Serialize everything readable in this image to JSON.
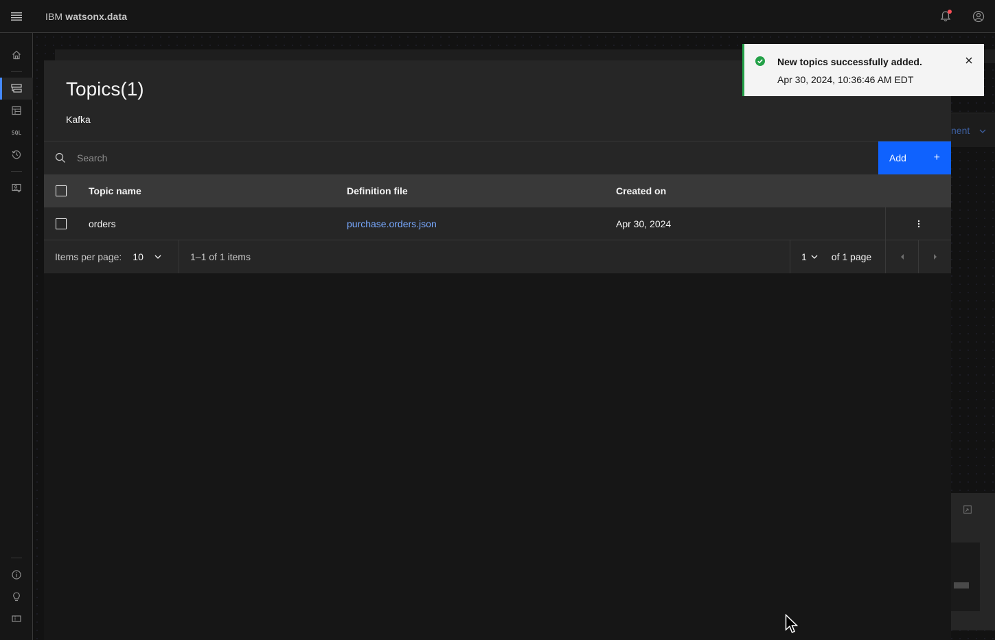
{
  "header": {
    "brand_prefix": "IBM",
    "brand_name": "watsonx.data"
  },
  "icons": {
    "menu": "hamburger-menu-icon",
    "notifications": "bell-icon",
    "user": "user-avatar-icon"
  },
  "sidenav": {
    "items": [
      "home",
      "infrastructure-manager",
      "data-manager",
      "SQL",
      "query-history",
      "access-control"
    ],
    "bottom": [
      "info",
      "ideas",
      "ticket"
    ],
    "sql_label": "SQL"
  },
  "background": {
    "partial_text": "nent"
  },
  "modal": {
    "title": "Topics(1)",
    "subtitle": "Kafka",
    "search_placeholder": "Search",
    "add_label": "Add",
    "add_icon": "+",
    "columns": [
      "Topic name",
      "Definition file",
      "Created on"
    ],
    "rows": [
      {
        "name": "orders",
        "definition": "purchase.orders.json",
        "created": "Apr 30, 2024"
      }
    ],
    "pagination": {
      "items_per_page_label": "Items per page:",
      "items_per_page": "10",
      "range": "1–1 of 1 items",
      "page": "1",
      "of_pages": "of 1 page"
    }
  },
  "toast": {
    "title": "New topics successfully added.",
    "subtitle": "Apr 30, 2024, 10:36:46 AM EDT"
  },
  "colors": {
    "primary": "#0f62fe",
    "success": "#24a148",
    "link": "#78a9ff"
  }
}
